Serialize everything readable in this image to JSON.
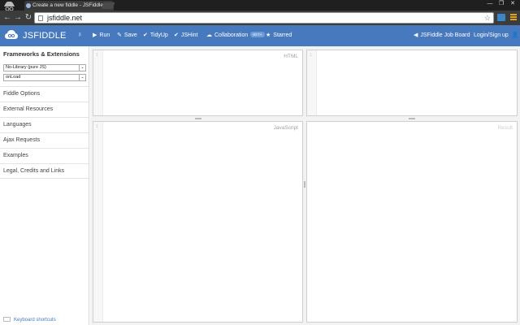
{
  "browser": {
    "tab_title": "Create a new fiddle - JSFiddle",
    "tab_close": "×",
    "url": "jsfiddle.net",
    "win_min": "—",
    "win_max": "❐",
    "win_close": "✕",
    "back": "←",
    "forward": "→",
    "reload": "↻",
    "star": "☆"
  },
  "header": {
    "logo_text": "JSFIDDLE",
    "logo_sub": "β",
    "nav": [
      {
        "icon": "▶",
        "label": "Run"
      },
      {
        "icon": "✎",
        "label": "Save"
      },
      {
        "icon": "✔",
        "label": "TidyUp"
      },
      {
        "icon": "✔",
        "label": "JSHint"
      },
      {
        "icon": "☁",
        "label": "Collaboration",
        "badge": "BETA"
      },
      {
        "icon": "★",
        "label": "Starred"
      }
    ],
    "job_board_icon": "◀",
    "job_board": "JSFiddle Job Board",
    "login": "Login/Sign up",
    "login_icon": "👤"
  },
  "sidebar": {
    "title": "Frameworks & Extensions",
    "library_select": "No-Library (pure JS)",
    "load_select": "onLoad",
    "dropdown_glyph": "⌄",
    "items": [
      "Fiddle Options",
      "External Resources",
      "Languages",
      "Ajax Requests",
      "Examples",
      "Legal, Credits and Links"
    ],
    "keyboard_shortcuts": "Keyboard shortcuts"
  },
  "panels": {
    "html": {
      "label": "HTML",
      "line": "1"
    },
    "css": {
      "label": "",
      "line": "1"
    },
    "js": {
      "label": "JavaScript",
      "line": "1"
    },
    "result": {
      "label": "Result"
    }
  },
  "colors": {
    "header": "#4679bd",
    "workspace": "#f2f2f2",
    "link": "#4679bd"
  }
}
